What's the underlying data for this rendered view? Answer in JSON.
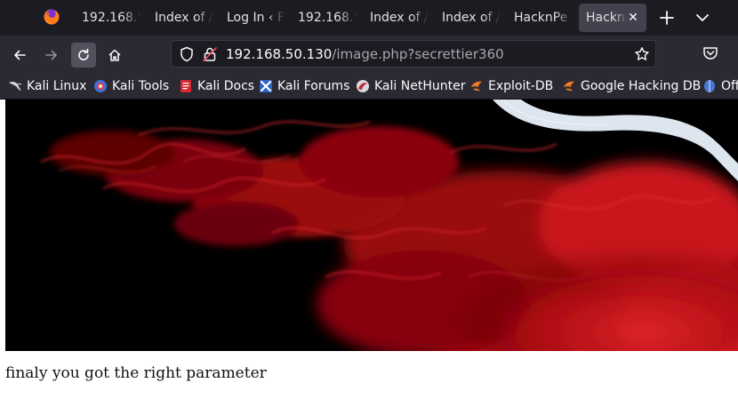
{
  "browser": {
    "tabs": [
      {
        "label": "192.168.5"
      },
      {
        "label": "Index of /"
      },
      {
        "label": "Log In ‹ F"
      },
      {
        "label": "192.168.5"
      },
      {
        "label": "Index of /"
      },
      {
        "label": "Index of /"
      },
      {
        "label": "HacknPe"
      },
      {
        "label": "Hackn",
        "active": true
      }
    ],
    "close_glyph": "✕",
    "url_host": "192.168.50.130",
    "url_path": "/image.php?secrettier360",
    "bookmarks": [
      {
        "label": "Kali Linux",
        "icon": "kali-dragon-icon"
      },
      {
        "label": "Kali Tools",
        "icon": "kali-tools-icon"
      },
      {
        "label": "Kali Docs",
        "icon": "kali-docs-icon"
      },
      {
        "label": "Kali Forums",
        "icon": "kali-forums-icon"
      },
      {
        "label": "Kali NetHunter",
        "icon": "nethunter-icon"
      },
      {
        "label": "Exploit-DB",
        "icon": "exploit-db-icon"
      },
      {
        "label": "Google Hacking DB",
        "icon": "ghdb-icon"
      },
      {
        "label": "Off",
        "icon": "offsec-icon"
      }
    ]
  },
  "page": {
    "caption": "finaly you got the right parameter"
  },
  "colors": {
    "tabstrip_bg": "#1c1b22",
    "toolbar_bg": "#2b2a33",
    "active_tab": "#42414d",
    "smoke_red": "#c8141a"
  }
}
